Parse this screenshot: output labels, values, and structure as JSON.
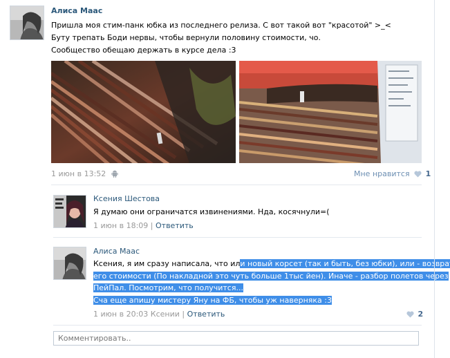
{
  "post": {
    "author": "Алиса Маас",
    "lines": [
      "Пришла моя стим-панк юбка из последнего релиза. С вот такой вот \"красотой\" >_<",
      "Буту трепать Боди нервы, чтобы вернули половину стоимости, чо.",
      "Сообщество обещаю держать в курсе дела :3"
    ],
    "date": "1 июн в 13:52",
    "likes_label": "Мне нравится",
    "likes_count": "1"
  },
  "comments": [
    {
      "author": "Ксения Шестова",
      "text": "Я думаю они ограничатся извинениями. Нда, косячнули=(",
      "date": "1 июн в 18:09",
      "sep": "|",
      "reply": "Ответить"
    },
    {
      "author": "Алиса Маас",
      "line1_a": "Ксения, я им сразу написала, что ил",
      "line1_b": "и новый корсет (так и быть, без юбки), или - возврат",
      "line2": "его стоимости (По накладной это чуть больше 1тыс йен). Иначе - разбор полетов через",
      "line3": "ПейПал. Посмотрим, что получится...",
      "line4": "Сча еще апишу мистеру Яну на ФБ, чтобы уж наверняка :3",
      "date": "1 июн в 20:03",
      "to": "Ксении",
      "sep": "|",
      "reply": "Ответить",
      "likes_count": "2"
    }
  ],
  "comment_input": {
    "placeholder": "Комментировать.."
  },
  "colors": {
    "link": "#2b587a",
    "highlight": "#3f8ee8",
    "meta": "#999999"
  }
}
